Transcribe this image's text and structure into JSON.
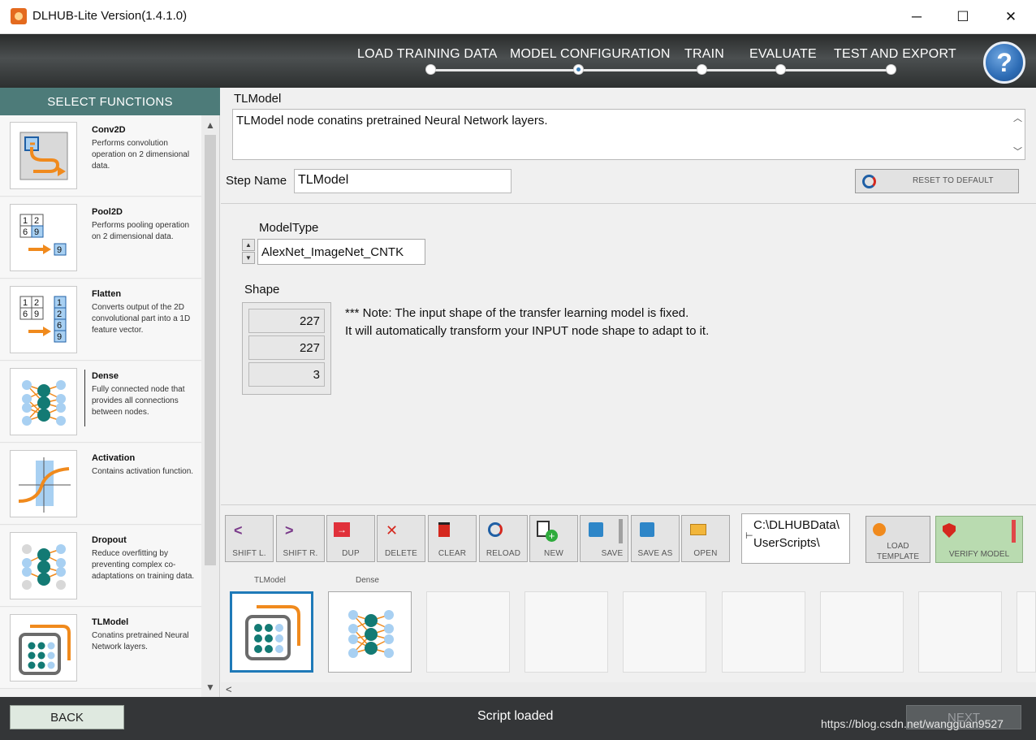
{
  "window": {
    "title": "DLHUB-Lite Version(1.4.1.0)",
    "minimize": "─",
    "maximize": "☐",
    "close": "✕"
  },
  "steps": [
    {
      "label": "LOAD TRAINING DATA"
    },
    {
      "label": "MODEL CONFIGURATION"
    },
    {
      "label": "TRAIN"
    },
    {
      "label": "EVALUATE"
    },
    {
      "label": "TEST AND EXPORT"
    }
  ],
  "active_step": "MODEL CONFIGURATION",
  "help_label": "?",
  "sidebar": {
    "header": "SELECT FUNCTIONS",
    "items": [
      {
        "name": "Conv2D",
        "desc": "Performs convolution operation on 2 dimensional data."
      },
      {
        "name": "Pool2D",
        "desc": "Performs pooling operation on 2 dimensional data."
      },
      {
        "name": "Flatten",
        "desc": "Converts output of the 2D convolutional part into a 1D feature vector."
      },
      {
        "name": "Dense",
        "desc": "Fully connected node that provides all connections between nodes."
      },
      {
        "name": "Activation",
        "desc": "Contains activation function."
      },
      {
        "name": "Dropout",
        "desc": "Reduce overfitting by preventing complex co-adaptations on training data."
      },
      {
        "name": "TLModel",
        "desc": "Conatins pretrained Neural Network layers."
      }
    ],
    "thumb_text": {
      "pool_grid": [
        "1",
        "2",
        "6",
        "9"
      ],
      "pool_out": "9",
      "flatten_grid": [
        "1",
        "2",
        "6",
        "9"
      ],
      "flatten_out": [
        "1",
        "2",
        "6",
        "9"
      ]
    }
  },
  "node": {
    "title": "TLModel",
    "description": "TLModel node conatins pretrained Neural Network layers.",
    "step_name_label": "Step Name",
    "step_name_value": "TLModel",
    "reset_label": "RESET TO DEFAULT",
    "model_type_label": "ModelType",
    "model_type_value": "AlexNet_ImageNet_CNTK",
    "shape_label": "Shape",
    "shape_values": [
      "227",
      "227",
      "3"
    ],
    "note_line1": "*** Note: The input shape of the transfer learning model is fixed.",
    "note_line2": "It will automatically transform your INPUT node shape to adapt to it."
  },
  "toolbar": {
    "buttons": [
      {
        "label": "SHIFT L.",
        "icon": "chevron-left-icon"
      },
      {
        "label": "SHIFT R.",
        "icon": "chevron-right-icon"
      },
      {
        "label": "DUP",
        "icon": "duplicate-icon"
      },
      {
        "label": "DELETE",
        "icon": "delete-x-icon"
      },
      {
        "label": "CLEAR",
        "icon": "trash-icon"
      },
      {
        "label": "RELOAD",
        "icon": "reload-icon"
      },
      {
        "label": "NEW",
        "icon": "new-file-icon"
      },
      {
        "label": "SAVE",
        "icon": "save-icon"
      },
      {
        "label": "SAVE AS",
        "icon": "save-as-icon"
      },
      {
        "label": "OPEN",
        "icon": "open-folder-icon"
      }
    ],
    "path_line1": "C:\\DLHUBData\\",
    "path_line2": "UserScripts\\",
    "load_template_line1": "LOAD",
    "load_template_line2": "TEMPLATE",
    "verify_label": "VERIFY MODEL"
  },
  "sequence": {
    "slots": [
      {
        "label": "TLModel"
      },
      {
        "label": "Dense"
      }
    ],
    "empty_slots": 7
  },
  "bottom": {
    "back_label": "BACK",
    "status": "Script loaded",
    "next_label": "NEXT",
    "watermark": "https://blog.csdn.net/wangguan9527"
  },
  "colors": {
    "accent_teal": "#4d7b79",
    "node_teal": "#137a74",
    "node_orange": "#f08a1d",
    "node_light_blue": "#a8d0f2",
    "selection_blue": "#1f7ab8",
    "verify_green": "#b9dbb0"
  }
}
